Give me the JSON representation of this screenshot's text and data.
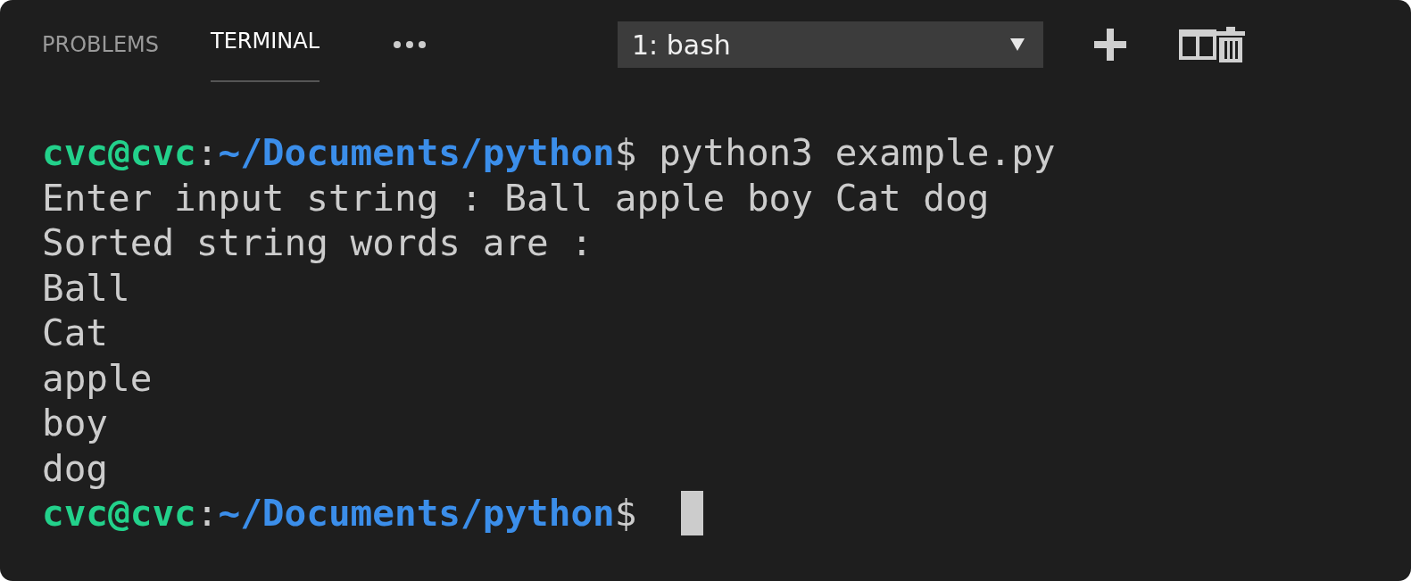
{
  "panel_tabs": [
    {
      "label": "PROBLEMS",
      "selected": false
    },
    {
      "label": "TERMINAL",
      "selected": true
    }
  ],
  "terminal_dropdown": {
    "value": "1: bash"
  },
  "terminal": {
    "lines": [
      {
        "segments": [
          {
            "kind": "user",
            "text": "cvc@cvc"
          },
          {
            "kind": "plain",
            "text": ":"
          },
          {
            "kind": "path",
            "text": "~/Documents/python"
          },
          {
            "kind": "plain",
            "text": "$ python3 example.py"
          }
        ]
      },
      {
        "segments": [
          {
            "kind": "plain",
            "text": "Enter input string : Ball apple boy Cat dog"
          }
        ]
      },
      {
        "segments": [
          {
            "kind": "plain",
            "text": "Sorted string words are :"
          }
        ]
      },
      {
        "segments": [
          {
            "kind": "plain",
            "text": "Ball"
          }
        ]
      },
      {
        "segments": [
          {
            "kind": "plain",
            "text": "Cat"
          }
        ]
      },
      {
        "segments": [
          {
            "kind": "plain",
            "text": "apple"
          }
        ]
      },
      {
        "segments": [
          {
            "kind": "plain",
            "text": "boy"
          }
        ]
      },
      {
        "segments": [
          {
            "kind": "plain",
            "text": "dog"
          }
        ]
      },
      {
        "segments": [
          {
            "kind": "user",
            "text": "cvc@cvc"
          },
          {
            "kind": "plain",
            "text": ":"
          },
          {
            "kind": "path",
            "text": "~/Documents/python"
          },
          {
            "kind": "plain",
            "text": "$ "
          }
        ],
        "cursor": true
      }
    ]
  }
}
